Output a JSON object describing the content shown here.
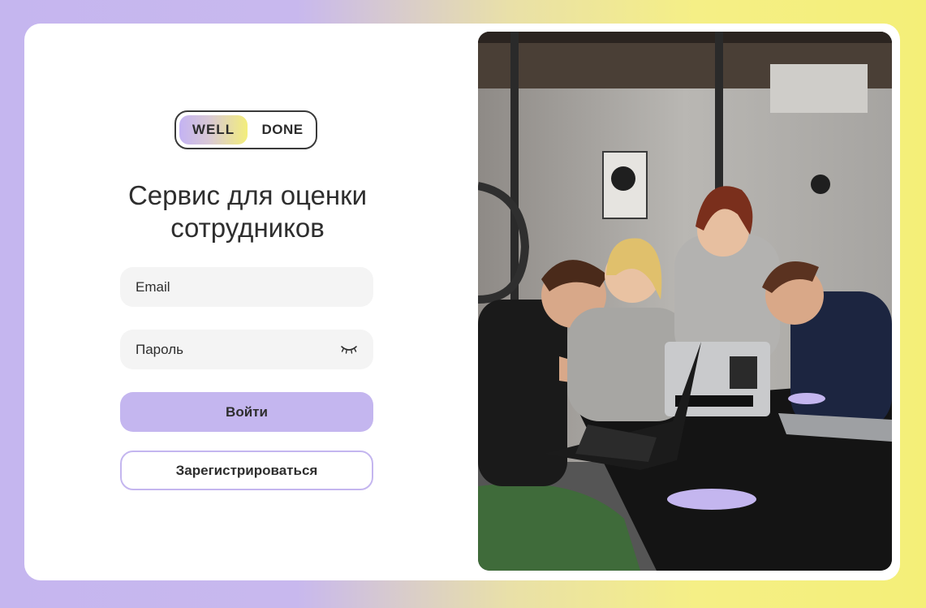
{
  "logo": {
    "left": "WELL",
    "right": "DONE"
  },
  "heading": {
    "line1": "Сервис для оценки",
    "line2": "сотрудников"
  },
  "form": {
    "email_placeholder": "Email",
    "password_placeholder": "Пароль",
    "password_toggle_icon": "eye-closed-icon",
    "login_label": "Войти",
    "register_label": "Зарегистрироваться"
  },
  "colors": {
    "accent": "#c4b6ef",
    "yellow": "#f4ef78",
    "text": "#2e2e2e",
    "field_bg": "#f4f4f4"
  }
}
